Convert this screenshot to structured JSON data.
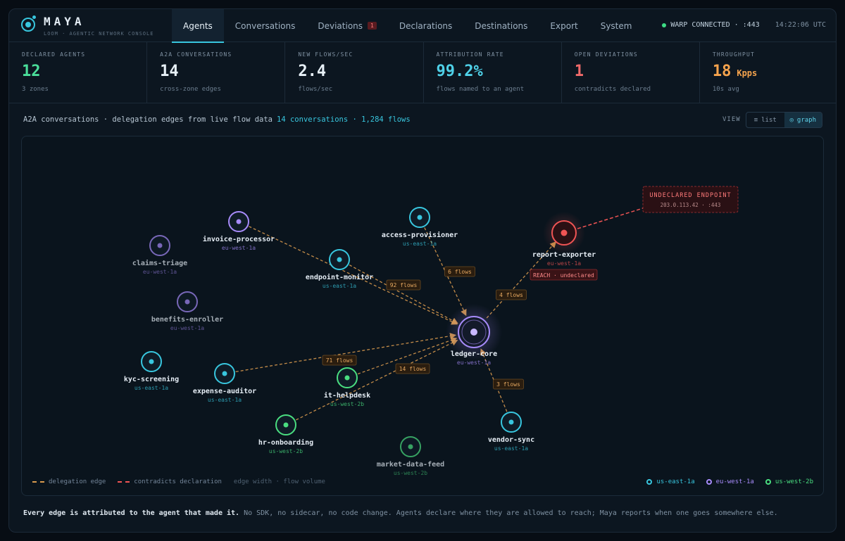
{
  "header": {
    "brand": "MAYA",
    "subtitle": "LOOM · AGENTIC NETWORK CONSOLE",
    "tabs": [
      {
        "label": "Agents",
        "active": true
      },
      {
        "label": "Conversations"
      },
      {
        "label": "Deviations",
        "badge": "1"
      },
      {
        "label": "Declarations"
      },
      {
        "label": "Destinations"
      },
      {
        "label": "Export"
      },
      {
        "label": "System"
      }
    ],
    "connection": "WARP CONNECTED · :443",
    "time": "14:22:06 UTC",
    "connection_color": "#3ddc84"
  },
  "stats": [
    {
      "label": "DECLARED AGENTS",
      "value": "12",
      "unit": "",
      "sub": "3 zones",
      "color": "#4ade9a"
    },
    {
      "label": "A2A CONVERSATIONS",
      "value": "14",
      "unit": "",
      "sub": "cross-zone edges",
      "color": "#e8f1f8"
    },
    {
      "label": "NEW FLOWS/SEC",
      "value": "2.4",
      "unit": "",
      "sub": "flows/sec",
      "color": "#e8f1f8"
    },
    {
      "label": "ATTRIBUTION RATE",
      "value": "99.2%",
      "unit": "",
      "sub": "flows named to an agent",
      "color": "#4fd1e8"
    },
    {
      "label": "OPEN DEVIATIONS",
      "value": "1",
      "unit": "",
      "sub": "contradicts declared",
      "color": "#f06a6a"
    },
    {
      "label": "THROUGHPUT",
      "value": "18",
      "unit": "Kpps",
      "sub": "10s avg",
      "color": "#f5a34d"
    }
  ],
  "section": {
    "title": "A2A conversations · delegation edges from live flow data",
    "count": "14 conversations · 1,284 flows",
    "view_label": "VIEW",
    "view_list": "list",
    "view_graph": "graph",
    "active_view": "graph"
  },
  "zones": {
    "us-east-1a": "#38c6de",
    "eu-west-1a": "#a78bfa",
    "us-west-2b": "#4ade80",
    "alert": "#f05454"
  },
  "graph": {
    "nodes": [
      {
        "id": "invoice-processor",
        "name": "invoice-processor",
        "zone": "eu-west-1a"
      },
      {
        "id": "claims-triage",
        "name": "claims-triage",
        "zone": "eu-west-1a",
        "dim": true
      },
      {
        "id": "benefits-enroller",
        "name": "benefits-enroller",
        "zone": "eu-west-1a",
        "dim": true
      },
      {
        "id": "endpoint-monitor",
        "name": "endpoint-monitor",
        "zone": "us-east-1a"
      },
      {
        "id": "access-provisioner",
        "name": "access-provisioner",
        "zone": "us-east-1a"
      },
      {
        "id": "report-exporter",
        "name": "report-exporter",
        "zone": "eu-west-1a",
        "alert": true
      },
      {
        "id": "ledger-core",
        "name": "ledger-core",
        "zone": "eu-west-1a",
        "hub": true
      },
      {
        "id": "kyc-screening",
        "name": "kyc-screening",
        "zone": "us-east-1a"
      },
      {
        "id": "expense-auditor",
        "name": "expense-auditor",
        "zone": "us-east-1a"
      },
      {
        "id": "it-helpdesk",
        "name": "it-helpdesk",
        "zone": "us-west-2b"
      },
      {
        "id": "hr-onboarding",
        "name": "hr-onboarding",
        "zone": "us-west-2b"
      },
      {
        "id": "market-data-feed",
        "name": "market-data-feed",
        "zone": "us-west-2b",
        "dim": true
      },
      {
        "id": "vendor-sync",
        "name": "vendor-sync",
        "zone": "us-east-1a"
      }
    ],
    "edges": [
      {
        "from": "invoice-processor",
        "to": "ledger-core",
        "label": ""
      },
      {
        "from": "endpoint-monitor",
        "to": "ledger-core",
        "label": "92 flows"
      },
      {
        "from": "access-provisioner",
        "to": "ledger-core",
        "label": "6 flows"
      },
      {
        "from": "ledger-core",
        "to": "report-exporter",
        "label": "4 flows"
      },
      {
        "from": "expense-auditor",
        "to": "ledger-core",
        "label": "71 flows"
      },
      {
        "from": "it-helpdesk",
        "to": "ledger-core",
        "label": ""
      },
      {
        "from": "hr-onboarding",
        "to": "ledger-core",
        "label": "14 flows"
      },
      {
        "from": "vendor-sync",
        "to": "ledger-core",
        "label": "3 flows"
      }
    ],
    "alert_edge": {
      "from": "report-exporter",
      "to": "undeclared-endpoint",
      "tag": "REACH · undeclared"
    },
    "undeclared_endpoint": {
      "title": "UNDECLARED ENDPOINT",
      "address": "203.0.113.42 · :443"
    },
    "edge_color": "#d99a4e"
  },
  "legend": {
    "delegation": "delegation edge",
    "contradicts": "contradicts declaration",
    "note": "edge width · flow volume",
    "zones": [
      "us-east-1a",
      "eu-west-1a",
      "us-west-2b"
    ]
  },
  "footer": {
    "bold": "Every edge is attributed to the agent that made it.",
    "rest": " No SDK, no sidecar, no code change. Agents declare where they are allowed to reach; Maya reports when one goes somewhere else."
  }
}
